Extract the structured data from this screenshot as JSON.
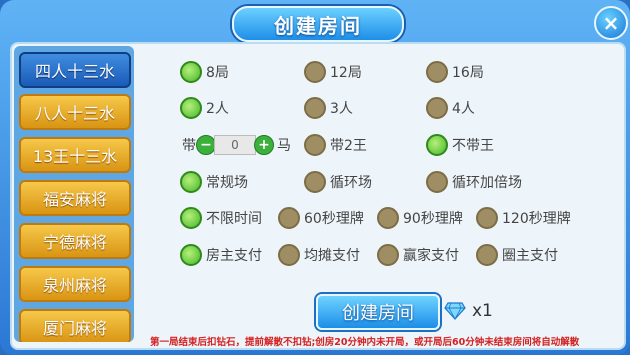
{
  "window": {
    "title": "创建房间",
    "close_icon": "×"
  },
  "sidebar": {
    "items": [
      {
        "label": "四人十三水",
        "active": true
      },
      {
        "label": "八人十三水",
        "active": false
      },
      {
        "label": "13王十三水",
        "active": false
      },
      {
        "label": "福安麻将",
        "active": false
      },
      {
        "label": "宁德麻将",
        "active": false
      },
      {
        "label": "泉州麻将",
        "active": false
      },
      {
        "label": "厦门麻将",
        "active": false
      }
    ]
  },
  "options": {
    "rounds": [
      {
        "label": "8局",
        "selected": true
      },
      {
        "label": "12局",
        "selected": false
      },
      {
        "label": "16局",
        "selected": false
      }
    ],
    "players": [
      {
        "label": "2人",
        "selected": true
      },
      {
        "label": "3人",
        "selected": false
      },
      {
        "label": "4人",
        "selected": false
      }
    ],
    "horse": {
      "prefix": "带",
      "value": "0",
      "suffix": "马"
    },
    "king": [
      {
        "label": "带2王",
        "selected": false
      },
      {
        "label": "不带王",
        "selected": true
      }
    ],
    "mode": [
      {
        "label": "常规场",
        "selected": true
      },
      {
        "label": "循环场",
        "selected": false
      },
      {
        "label": "循环加倍场",
        "selected": false
      }
    ],
    "time": [
      {
        "label": "不限时间",
        "selected": true
      },
      {
        "label": "60秒理牌",
        "selected": false
      },
      {
        "label": "90秒理牌",
        "selected": false
      },
      {
        "label": "120秒理牌",
        "selected": false
      }
    ],
    "payment": [
      {
        "label": "房主支付",
        "selected": true
      },
      {
        "label": "均摊支付",
        "selected": false
      },
      {
        "label": "赢家支付",
        "selected": false
      },
      {
        "label": "圈主支付",
        "selected": false
      }
    ]
  },
  "footer": {
    "create_label": "创建房间",
    "cost": "x1",
    "notice": "第一局结束后扣钻石，提前解散不扣钻;创房20分钟内未开局，或开局后60分钟未结束房间将自动解散"
  },
  "colors": {
    "accent": "#2b78d4",
    "selected": "#45b52a",
    "unselected": "#9f8e63",
    "sidebar_button": "#f6c84a",
    "notice": "#d42020"
  }
}
